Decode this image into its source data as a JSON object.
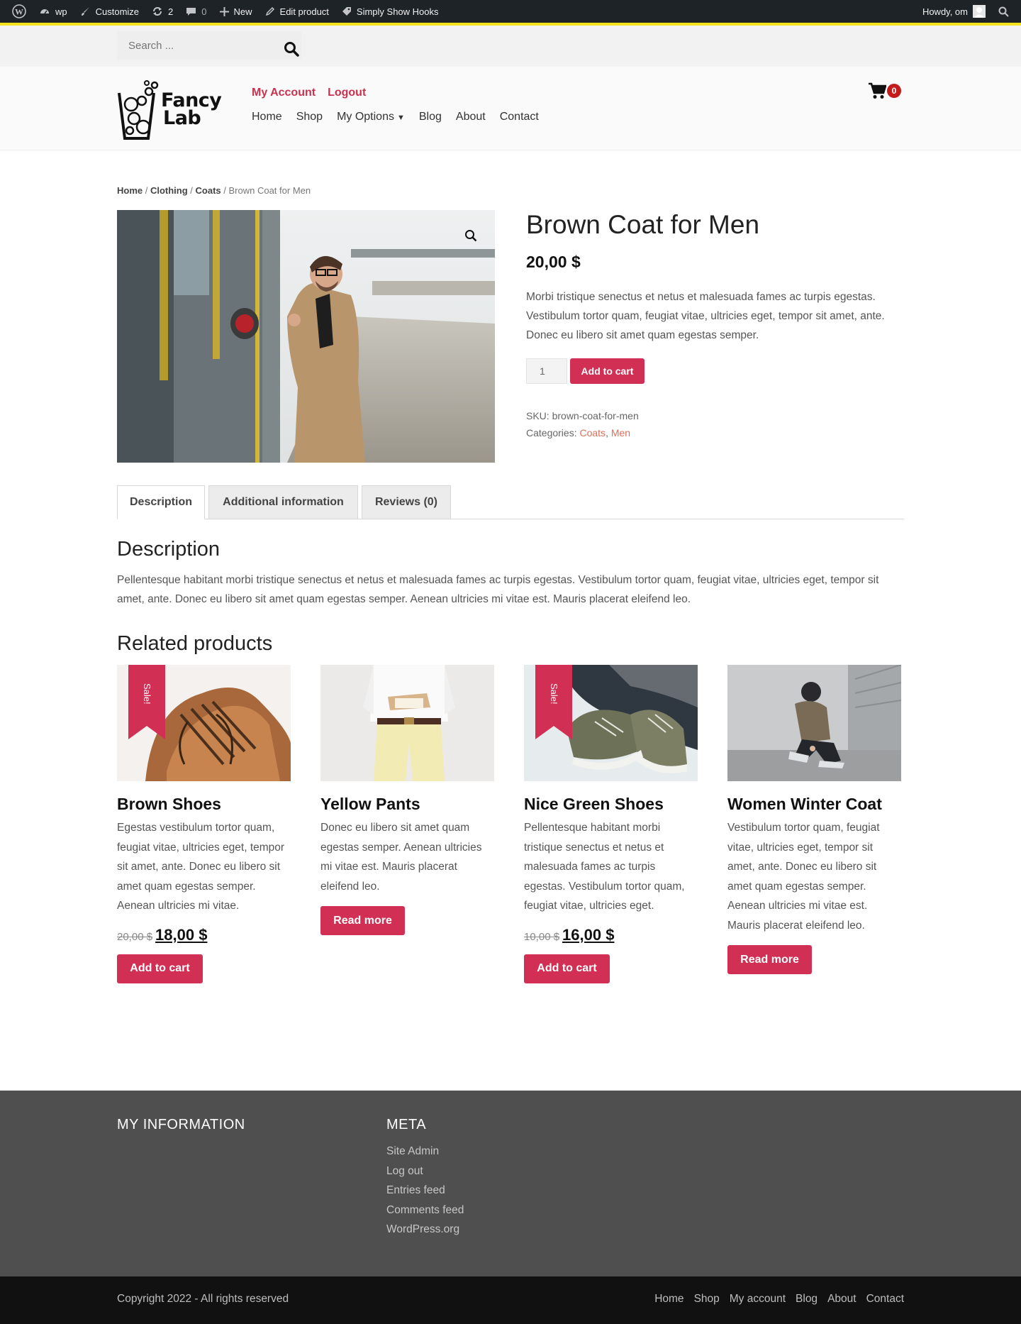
{
  "adminbar": {
    "site": "wp",
    "customize": "Customize",
    "updates": "2",
    "comments": "0",
    "new": "New",
    "edit": "Edit product",
    "hooks": "Simply Show Hooks",
    "howdy": "Howdy, om"
  },
  "search": {
    "placeholder": "Search ..."
  },
  "header": {
    "logo_line1": "Fancy",
    "logo_line2": "Lab",
    "account_links": [
      "My Account",
      "Logout"
    ],
    "nav": [
      "Home",
      "Shop",
      "My Options",
      "Blog",
      "About",
      "Contact"
    ],
    "cart_count": "0"
  },
  "breadcrumb": {
    "home": "Home",
    "cat1": "Clothing",
    "cat2": "Coats",
    "current": "Brown Coat for Men"
  },
  "product": {
    "title": "Brown Coat for Men",
    "price": "20,00 $",
    "short_desc": "Morbi tristique senectus et netus et malesuada fames ac turpis egestas. Vestibulum tortor quam, feugiat vitae, ultricies eget, tempor sit amet, ante. Donec eu libero sit amet quam egestas semper.",
    "qty": "1",
    "add_to_cart": "Add to cart",
    "sku_label": "SKU:",
    "sku": "brown-coat-for-men",
    "categories_label": "Categories:",
    "cat_a": "Coats",
    "cat_b": "Men"
  },
  "tabs": [
    "Description",
    "Additional information",
    "Reviews (0)"
  ],
  "description": {
    "heading": "Description",
    "text": "Pellentesque habitant morbi tristique senectus et netus et malesuada fames ac turpis egestas. Vestibulum tortor quam, feugiat vitae, ultricies eget, tempor sit amet, ante. Donec eu libero sit amet quam egestas semper. Aenean ultricies mi vitae est. Mauris placerat eleifend leo."
  },
  "related": {
    "heading": "Related products",
    "sale_label": "Sale!",
    "items": [
      {
        "title": "Brown Shoes",
        "desc": "Egestas vestibulum tortor quam, feugiat vitae, ultricies eget, tempor sit amet, ante. Donec eu libero sit amet quam egestas semper. Aenean ultricies mi vitae.",
        "old_price": "20,00 $",
        "price": "18,00 $",
        "button": "Add to cart"
      },
      {
        "title": "Yellow Pants",
        "desc": "Donec eu libero sit amet quam egestas semper. Aenean ultricies mi vitae est. Mauris placerat eleifend leo.",
        "button": "Read more"
      },
      {
        "title": "Nice Green Shoes",
        "desc": "Pellentesque habitant morbi tristique senectus et netus et malesuada fames ac turpis egestas. Vestibulum tortor quam, feugiat vitae, ultricies eget.",
        "old_price": "10,00 $",
        "price": "16,00 $",
        "button": "Add to cart"
      },
      {
        "title": "Women Winter Coat",
        "desc": "Vestibulum tortor quam, feugiat vitae, ultricies eget, tempor sit amet, ante. Donec eu libero sit amet quam egestas semper. Aenean ultricies mi vitae est. Mauris placerat eleifend leo.",
        "button": "Read more"
      }
    ]
  },
  "footer": {
    "col1_heading": "MY INFORMATION",
    "col2_heading": "META",
    "meta_links": [
      "Site Admin",
      "Log out",
      "Entries feed",
      "Comments feed",
      "WordPress.org"
    ],
    "copyright": "Copyright 2022 - All rights reserved",
    "nav": [
      "Home",
      "Shop",
      "My account",
      "Blog",
      "About",
      "Contact"
    ]
  },
  "colors": {
    "accent": "#d22f55",
    "admin_bar": "#1d2327",
    "footer": "#4f4f4f",
    "badge": "#c41b1b"
  }
}
